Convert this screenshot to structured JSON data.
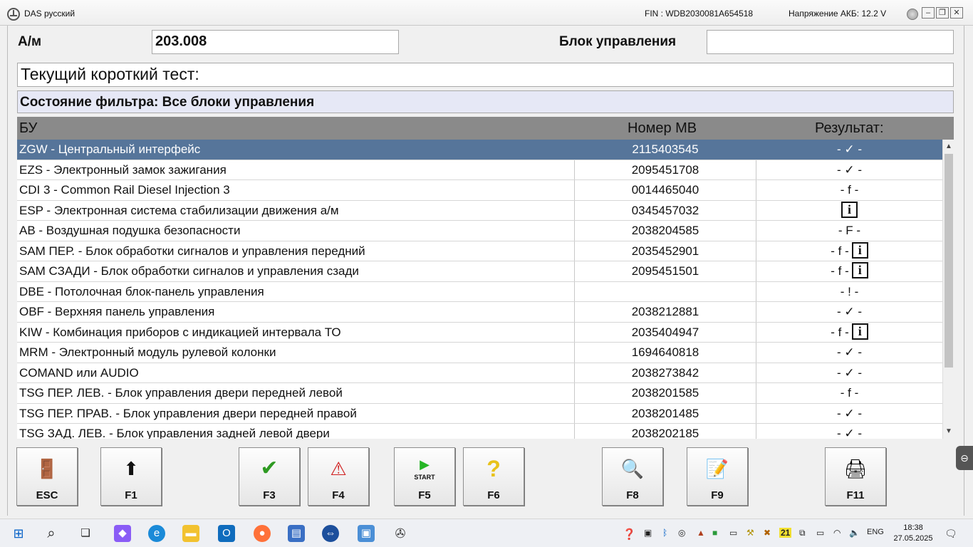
{
  "window": {
    "title": "DAS русский",
    "fin": "FIN : WDB2030081A654518",
    "voltage": "Напряжение АКБ: 12.2 V",
    "controls": {
      "minimize": "–",
      "restore": "❐",
      "close": "✕"
    }
  },
  "form": {
    "vehicle_label": "А/м",
    "vehicle_value": "203.008",
    "ecu_label": "Блок управления",
    "ecu_value": "",
    "short_test": "Текущий короткий тест:",
    "filter_state": "Состояние фильтра: Все блоки управления"
  },
  "table": {
    "headers": {
      "bu": "БУ",
      "mb": "Номер МВ",
      "result": "Результат:"
    },
    "rows": [
      {
        "bu": "ZGW - Центральный интерфейс",
        "mb": "2115403545",
        "result": "- ✓ -",
        "info": false,
        "selected": true
      },
      {
        "bu": "EZS - Электронный замок зажигания",
        "mb": "2095451708",
        "result": "- ✓ -",
        "info": false
      },
      {
        "bu": "CDI 3 - Common Rail Diesel Injection 3",
        "mb": "0014465040",
        "result": "- f -",
        "info": false
      },
      {
        "bu": "ESP - Электронная система стабилизации движения а/м",
        "mb": "0345457032",
        "result": "",
        "info": true
      },
      {
        "bu": "AB - Воздушная подушка безопасности",
        "mb": "2038204585",
        "result": "- F -",
        "info": false
      },
      {
        "bu": "SAM ПЕР. - Блок обработки сигналов и управления передний",
        "mb": "2035452901",
        "result": "- f -",
        "info": true
      },
      {
        "bu": "SAM СЗАДИ - Блок обработки сигналов и управления сзади",
        "mb": "2095451501",
        "result": "- f -",
        "info": true
      },
      {
        "bu": "DBE - Потолочная блок-панель управления",
        "mb": "",
        "result": "- ! -",
        "info": false
      },
      {
        "bu": "OBF - Верхняя панель управления",
        "mb": "2038212881",
        "result": "- ✓ -",
        "info": false
      },
      {
        "bu": "KIW - Комбинация приборов с индикацией интервала ТО",
        "mb": "2035404947",
        "result": "- f -",
        "info": true
      },
      {
        "bu": "MRM - Электронный модуль рулевой колонки",
        "mb": "1694640818",
        "result": "- ✓ -",
        "info": false
      },
      {
        "bu": "COMAND или AUDIO",
        "mb": "2038273842",
        "result": "- ✓ -",
        "info": false
      },
      {
        "bu": "TSG ПЕР. ЛЕВ. - Блок управления двери передней левой",
        "mb": "2038201585",
        "result": "- f -",
        "info": false
      },
      {
        "bu": "TSG ПЕР. ПРАВ. - Блок управления двери передней правой",
        "mb": "2038201485",
        "result": "- ✓ -",
        "info": false
      },
      {
        "bu": "TSG ЗАД. ЛЕВ. - Блок управления задней левой двери",
        "mb": "2038202185",
        "result": "- ✓ -",
        "info": false
      }
    ],
    "info_glyph": "i"
  },
  "fkeys": [
    {
      "label": "ESC",
      "icon": "exit-door-icon",
      "glyph": "🚪"
    },
    {
      "label": "F1",
      "icon": "arrow-up-icon",
      "glyph": "⬆"
    },
    {
      "label": "F3",
      "icon": "checkmark-icon",
      "glyph": "✔"
    },
    {
      "label": "F4",
      "icon": "warning-info-icon",
      "glyph": "⚠"
    },
    {
      "label": "F5",
      "icon": "start-icon",
      "glyph": "▶"
    },
    {
      "label": "F6",
      "icon": "help-icon",
      "glyph": "?"
    },
    {
      "label": "F8",
      "icon": "magnifier-icon",
      "glyph": "🔍"
    },
    {
      "label": "F9",
      "icon": "notepad-icon",
      "glyph": "📝"
    },
    {
      "label": "F11",
      "icon": "printer-icon",
      "glyph": "🖨"
    }
  ],
  "start_caption": "START",
  "taskbar": {
    "lang": "ENG",
    "time": "18:38",
    "date": "27.05.2025",
    "badge": "21"
  },
  "colors": {
    "selected_row": "#56759a",
    "header_bg": "#8a8a8a",
    "filter_bg": "#e6e8f6",
    "check_green": "#2e9a22"
  }
}
